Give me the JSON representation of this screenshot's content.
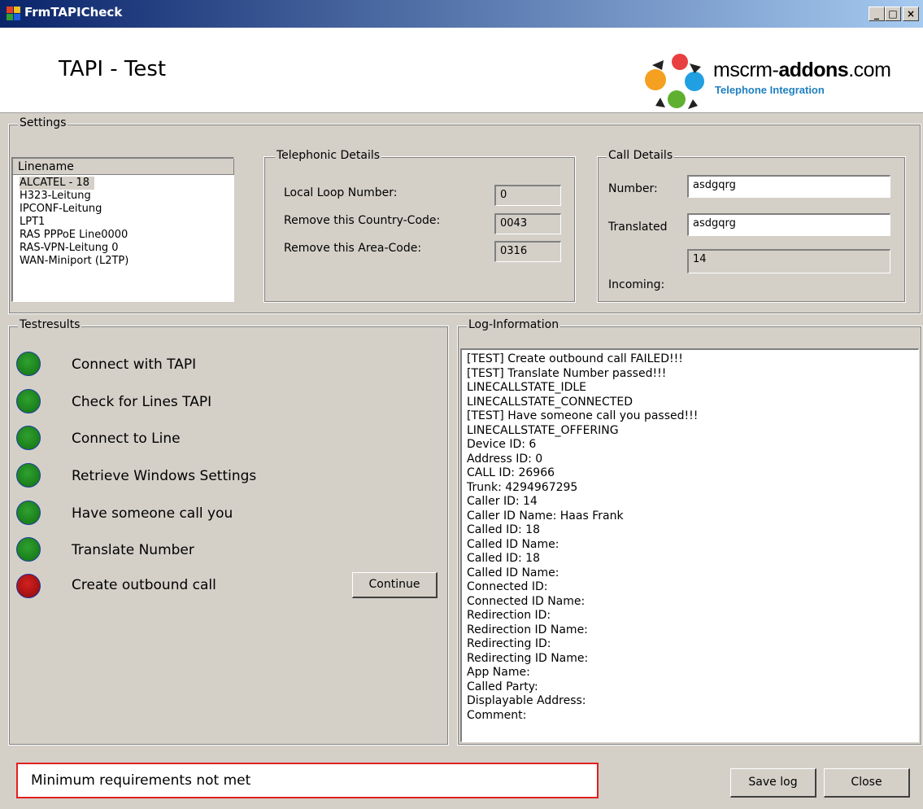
{
  "window": {
    "title": "FrmTAPICheck",
    "controls": {
      "minimize": "_",
      "maximize": "□",
      "close": "×"
    }
  },
  "header": {
    "heading": "TAPI - Test",
    "logo": {
      "brand_plain": "mscrm-",
      "brand_bold": "addons",
      "brand_suffix": ".com",
      "tagline": "Telephone Integration"
    }
  },
  "settings": {
    "title": "Settings",
    "lines": {
      "column_header": "Linename",
      "items": [
        "ALCATEL - 18",
        "H323-Leitung",
        "IPCONF-Leitung",
        "LPT1",
        "RAS PPPoE Line0000",
        "RAS-VPN-Leitung 0",
        "WAN-Miniport (L2TP)"
      ],
      "selected": "ALCATEL - 18"
    },
    "telephonic": {
      "title": "Telephonic Details",
      "local_loop_label": "Local Loop Number:",
      "local_loop_value": "0",
      "country_code_label": "Remove this Country-Code:",
      "country_code_value": "0043",
      "area_code_label": "Remove this Area-Code:",
      "area_code_value": "0316"
    },
    "call": {
      "title": "Call Details",
      "number_label": "Number:",
      "number_value": "asdgqrg",
      "translated_label": "Translated",
      "translated_value": "asdgqrg",
      "incoming_label": "Incoming:",
      "incoming_value": "14"
    }
  },
  "testresults": {
    "title": "Testresults",
    "items": [
      {
        "label": "Connect with TAPI",
        "status": "pass"
      },
      {
        "label": "Check for Lines TAPI",
        "status": "pass"
      },
      {
        "label": "Connect to Line",
        "status": "pass"
      },
      {
        "label": "Retrieve Windows Settings",
        "status": "pass"
      },
      {
        "label": "Have someone call you",
        "status": "pass"
      },
      {
        "label": "Translate Number",
        "status": "pass"
      },
      {
        "label": "Create outbound call",
        "status": "fail"
      }
    ],
    "continue_label": "Continue"
  },
  "log": {
    "title": "Log-Information",
    "lines": [
      "[TEST] Create outbound call FAILED!!!",
      "[TEST] Translate Number passed!!!",
      "LINECALLSTATE_IDLE",
      "LINECALLSTATE_CONNECTED",
      "[TEST] Have someone call you passed!!!",
      "LINECALLSTATE_OFFERING",
      "Device ID: 6",
      "Address ID: 0",
      "CALL ID: 26966",
      "Trunk: 4294967295",
      "Caller ID: 14",
      "Caller ID Name: Haas Frank",
      "Called ID: 18",
      "Called ID Name:",
      "Called ID: 18",
      "Called ID Name:",
      "Connected ID:",
      "Connected ID Name:",
      "Redirection ID:",
      "Redirection ID Name:",
      "Redirecting ID:",
      "Redirecting ID Name:",
      "App Name:",
      "Called Party:",
      "Displayable Address:",
      "Comment:"
    ]
  },
  "footer": {
    "status_message": "Minimum requirements not met",
    "save_log_label": "Save log",
    "close_label": "Close"
  },
  "colors": {
    "pass": "#1f8f1f",
    "fail": "#c81818",
    "status_border": "#e02020",
    "titlebar": "#0a246a"
  }
}
